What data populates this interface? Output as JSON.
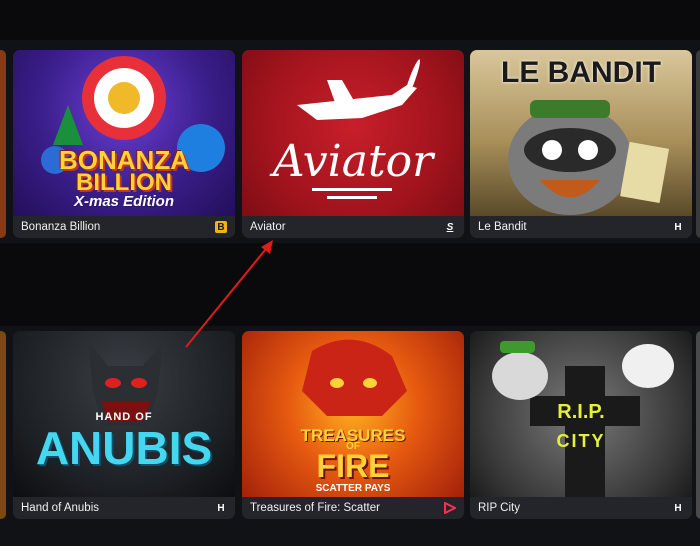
{
  "colors": {
    "page_bg": "#111215",
    "band_bg": "#0a0a0c",
    "card_footer": "#24252a",
    "annotation_arrow": "#e01b1b"
  },
  "rows": [
    {
      "cards": [
        {
          "name": "Bonanza Billion",
          "art_text": {
            "line1": "BONANZA",
            "line2": "BILLION",
            "line3": "X-mas Edition"
          },
          "provider_icon": "b-square-icon",
          "provider_glyph": "B"
        },
        {
          "name": "Aviator",
          "art_text": {
            "line1": "Aviator"
          },
          "provider_icon": "spribe-s-icon",
          "provider_glyph": "S"
        },
        {
          "name": "Le Bandit",
          "art_text": {
            "line1": "LE BANDIT"
          },
          "provider_icon": "hacksaw-h-icon",
          "provider_glyph": "H"
        }
      ]
    },
    {
      "cards": [
        {
          "name": "Hand of Anubis",
          "art_text": {
            "line1": "HAND OF",
            "line2": "ANUBIS"
          },
          "provider_icon": "hacksaw-h-icon",
          "provider_glyph": "H"
        },
        {
          "name": "Treasures of Fire: Scatter",
          "art_text": {
            "line1": "TREASURES",
            "line2": "OF",
            "line3": "FIRE",
            "line4": "SCATTER PAYS"
          },
          "provider_icon": "play-triangle-icon",
          "provider_glyph": ""
        },
        {
          "name": "RIP City",
          "art_text": {
            "line1": "R.I.P.",
            "line2": "CITY"
          },
          "provider_icon": "hacksaw-h-icon",
          "provider_glyph": "H"
        }
      ]
    }
  ]
}
